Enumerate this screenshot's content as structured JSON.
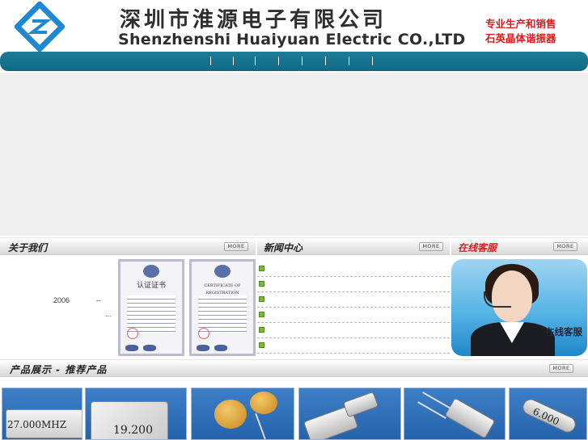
{
  "header": {
    "company_cn": "深圳市淮源电子有限公司",
    "company_en": "Shenzhenshi Huaiyuan Electric CO.,LTD",
    "slogan_line1": "专业生产和销售",
    "slogan_line2": "石英晶体谐振器"
  },
  "nav": {
    "separator": "|"
  },
  "about": {
    "title": "关于我们",
    "more": "MORE",
    "year_text": "2006",
    "dash_text": "--",
    "ellipsis_text": "...",
    "certificates": [
      {
        "title": "认证证书"
      },
      {
        "title": "CERTIFICATE OF REGISTRATION"
      }
    ]
  },
  "news": {
    "title": "新闻中心",
    "more": "MORE",
    "items_count": 6
  },
  "service": {
    "title": "在线客服",
    "more": "MORE",
    "photo_label": "在线客服"
  },
  "products": {
    "title": "产品展示 - 推荐产品",
    "more": "MORE",
    "items": [
      {
        "text": "27.000MHZ"
      },
      {
        "text": "19.200"
      },
      {
        "text": ""
      },
      {
        "text": ""
      },
      {
        "text": ""
      },
      {
        "text": "6.000"
      }
    ]
  },
  "colors": {
    "nav_bar": "#1679a0",
    "accent_red": "#d81b1b",
    "news_bullet": "#7ab73a",
    "product_bg": "#2f6fb9"
  }
}
